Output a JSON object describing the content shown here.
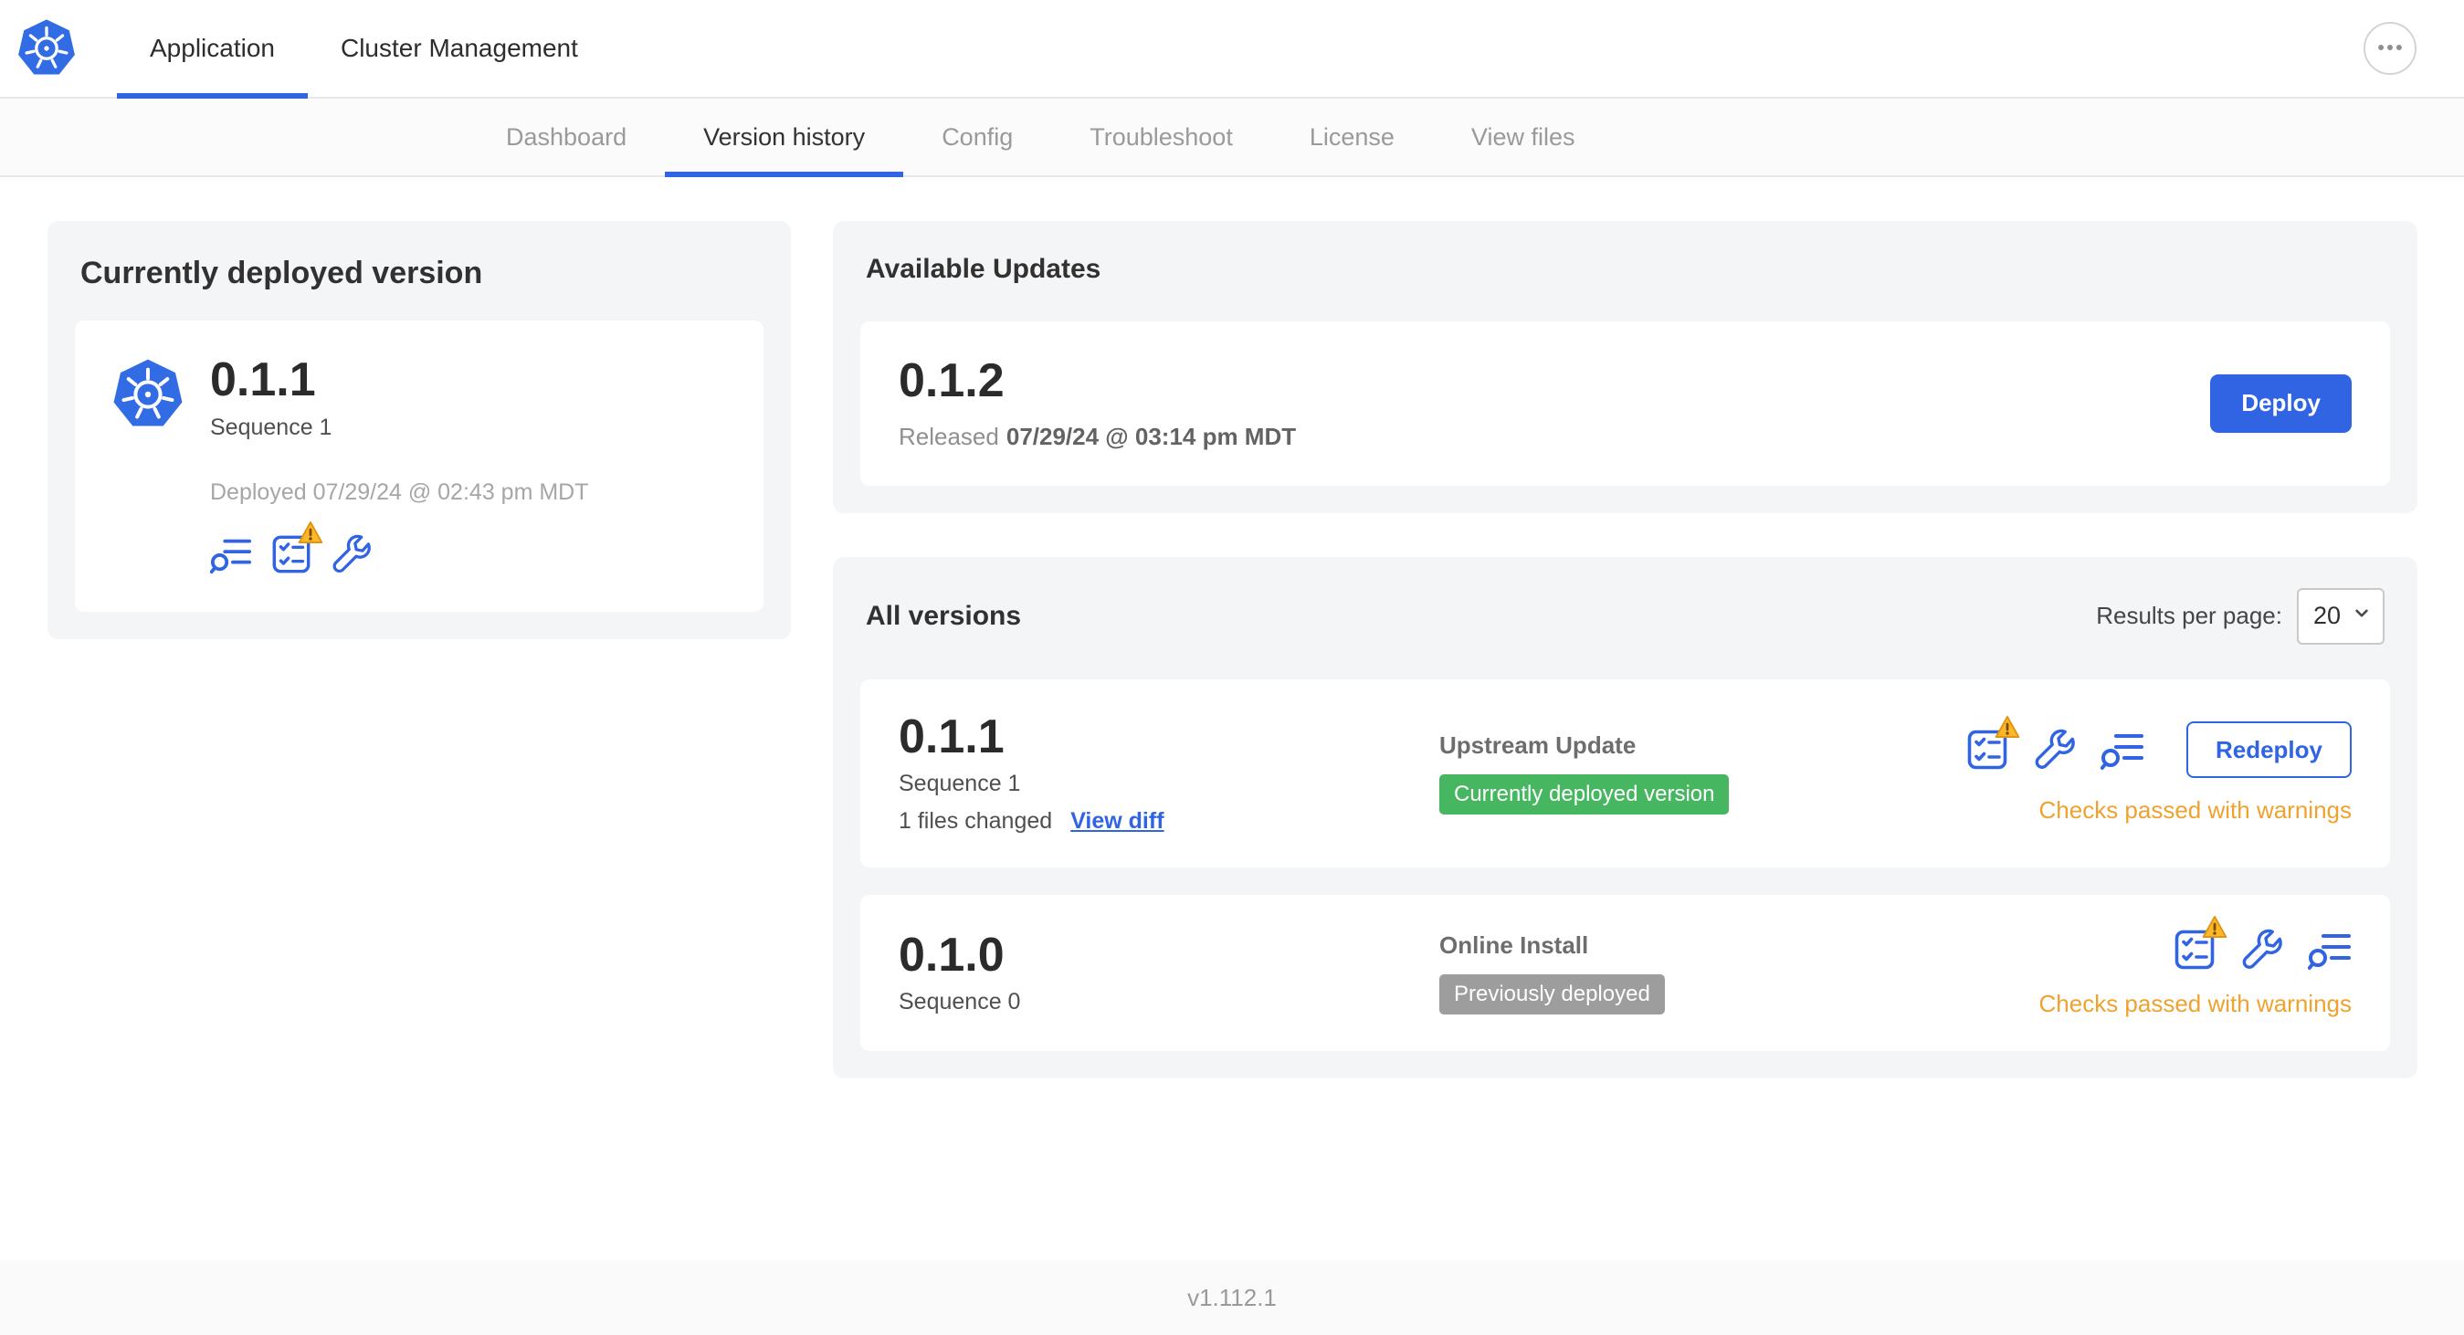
{
  "topbar": {
    "tabs": [
      {
        "label": "Application",
        "active": true
      },
      {
        "label": "Cluster Management",
        "active": false
      }
    ]
  },
  "subnav": {
    "tabs": [
      {
        "label": "Dashboard",
        "active": false
      },
      {
        "label": "Version history",
        "active": true
      },
      {
        "label": "Config",
        "active": false
      },
      {
        "label": "Troubleshoot",
        "active": false
      },
      {
        "label": "License",
        "active": false
      },
      {
        "label": "View files",
        "active": false
      }
    ]
  },
  "current_version": {
    "title": "Currently deployed version",
    "version": "0.1.1",
    "sequence": "Sequence 1",
    "deployed": "Deployed 07/29/24 @ 02:43 pm MDT"
  },
  "available_updates": {
    "title": "Available Updates",
    "version": "0.1.2",
    "released_prefix": "Released",
    "released_date": "07/29/24 @ 03:14 pm MDT",
    "deploy_label": "Deploy"
  },
  "all_versions": {
    "title": "All versions",
    "results_per_page_label": "Results per page:",
    "results_per_page_value": "20",
    "rows": [
      {
        "version": "0.1.1",
        "sequence": "Sequence 1",
        "files_changed": "1 files changed",
        "view_diff_label": "View diff",
        "source": "Upstream Update",
        "badge": "Currently deployed version",
        "badge_color": "#47b661",
        "status": "Checks passed with warnings",
        "action_label": "Redeploy"
      },
      {
        "version": "0.1.0",
        "sequence": "Sequence 0",
        "source": "Online Install",
        "badge": "Previously deployed",
        "badge_color": "#9d9d9d",
        "status": "Checks passed with warnings"
      }
    ]
  },
  "footer": {
    "version": "v1.112.1"
  },
  "icons": {
    "logo": "kubernetes-helm-icon",
    "more_menu": "ellipsis-icon",
    "release_notes": "release-notes-icon",
    "preflight": "preflight-checks-icon",
    "config": "config-wrench-icon",
    "warning": "warning-triangle-icon",
    "select_chevron": "chevron-down-icon"
  },
  "colors": {
    "accent": "#3064e3",
    "logo_blue": "#326ce5",
    "badge_green": "#47b661",
    "badge_gray": "#9d9d9d",
    "warning_text": "#efa22e"
  }
}
